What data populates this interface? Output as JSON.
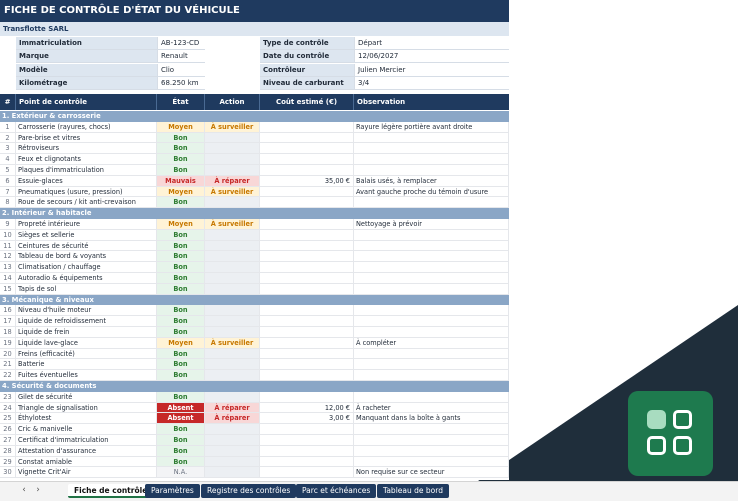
{
  "title": "FICHE DE CONTRÔLE D'ÉTAT DU VÉHICULE",
  "company": "Transflotte SARL",
  "info_left": [
    {
      "label": "Immatriculation",
      "value": "AB-123-CD"
    },
    {
      "label": "Marque",
      "value": "Renault"
    },
    {
      "label": "Modèle",
      "value": "Clio"
    },
    {
      "label": "Kilométrage",
      "value": "68.250 km"
    }
  ],
  "info_right": [
    {
      "label": "Type de contrôle",
      "value": "Départ"
    },
    {
      "label": "Date du contrôle",
      "value": "12/06/2027"
    },
    {
      "label": "Contrôleur",
      "value": "Julien Mercier"
    },
    {
      "label": "Niveau de carburant",
      "value": "3/4"
    }
  ],
  "headers": {
    "num": "#",
    "point": "Point de contrôle",
    "state": "État",
    "action": "Action",
    "cost": "Coût estimé (€)",
    "obs": "Observation"
  },
  "sections": [
    {
      "title": "1. Extérieur & carrosserie",
      "rows": [
        {
          "n": "1",
          "point": "Carrosserie (rayures, chocs)",
          "state": "Moyen",
          "action": "À surveiller",
          "cost": "",
          "obs": "Rayure légère portière avant droite"
        },
        {
          "n": "2",
          "point": "Pare-brise et vitres",
          "state": "Bon",
          "action": "",
          "cost": "",
          "obs": ""
        },
        {
          "n": "3",
          "point": "Rétroviseurs",
          "state": "Bon",
          "action": "",
          "cost": "",
          "obs": ""
        },
        {
          "n": "4",
          "point": "Feux et clignotants",
          "state": "Bon",
          "action": "",
          "cost": "",
          "obs": ""
        },
        {
          "n": "5",
          "point": "Plaques d'immatriculation",
          "state": "Bon",
          "action": "",
          "cost": "",
          "obs": ""
        },
        {
          "n": "6",
          "point": "Essuie-glaces",
          "state": "Mauvais",
          "action": "À réparer",
          "cost": "35,00 €",
          "obs": "Balais usés, à remplacer"
        },
        {
          "n": "7",
          "point": "Pneumatiques (usure, pression)",
          "state": "Moyen",
          "action": "À surveiller",
          "cost": "",
          "obs": "Avant gauche proche du témoin d'usure"
        },
        {
          "n": "8",
          "point": "Roue de secours / kit anti-crevaison",
          "state": "Bon",
          "action": "",
          "cost": "",
          "obs": ""
        }
      ]
    },
    {
      "title": "2. Intérieur & habitacle",
      "rows": [
        {
          "n": "9",
          "point": "Propreté intérieure",
          "state": "Moyen",
          "action": "À surveiller",
          "cost": "",
          "obs": "Nettoyage à prévoir"
        },
        {
          "n": "10",
          "point": "Sièges et sellerie",
          "state": "Bon",
          "action": "",
          "cost": "",
          "obs": ""
        },
        {
          "n": "11",
          "point": "Ceintures de sécurité",
          "state": "Bon",
          "action": "",
          "cost": "",
          "obs": ""
        },
        {
          "n": "12",
          "point": "Tableau de bord & voyants",
          "state": "Bon",
          "action": "",
          "cost": "",
          "obs": ""
        },
        {
          "n": "13",
          "point": "Climatisation / chauffage",
          "state": "Bon",
          "action": "",
          "cost": "",
          "obs": ""
        },
        {
          "n": "14",
          "point": "Autoradio & équipements",
          "state": "Bon",
          "action": "",
          "cost": "",
          "obs": ""
        },
        {
          "n": "15",
          "point": "Tapis de sol",
          "state": "Bon",
          "action": "",
          "cost": "",
          "obs": ""
        }
      ]
    },
    {
      "title": "3. Mécanique & niveaux",
      "rows": [
        {
          "n": "16",
          "point": "Niveau d'huile moteur",
          "state": "Bon",
          "action": "",
          "cost": "",
          "obs": ""
        },
        {
          "n": "17",
          "point": "Liquide de refroidissement",
          "state": "Bon",
          "action": "",
          "cost": "",
          "obs": ""
        },
        {
          "n": "18",
          "point": "Liquide de frein",
          "state": "Bon",
          "action": "",
          "cost": "",
          "obs": ""
        },
        {
          "n": "19",
          "point": "Liquide lave-glace",
          "state": "Moyen",
          "action": "À surveiller",
          "cost": "",
          "obs": "À compléter"
        },
        {
          "n": "20",
          "point": "Freins (efficacité)",
          "state": "Bon",
          "action": "",
          "cost": "",
          "obs": ""
        },
        {
          "n": "21",
          "point": "Batterie",
          "state": "Bon",
          "action": "",
          "cost": "",
          "obs": ""
        },
        {
          "n": "22",
          "point": "Fuites éventuelles",
          "state": "Bon",
          "action": "",
          "cost": "",
          "obs": ""
        }
      ]
    },
    {
      "title": "4. Sécurité & documents",
      "rows": [
        {
          "n": "23",
          "point": "Gilet de sécurité",
          "state": "Bon",
          "action": "",
          "cost": "",
          "obs": ""
        },
        {
          "n": "24",
          "point": "Triangle de signalisation",
          "state": "Absent",
          "action": "À réparer",
          "cost": "12,00 €",
          "obs": "À racheter"
        },
        {
          "n": "25",
          "point": "Éthylotest",
          "state": "Absent",
          "action": "À réparer",
          "cost": "3,00 €",
          "obs": "Manquant dans la boîte à gants"
        },
        {
          "n": "26",
          "point": "Cric & manivelle",
          "state": "Bon",
          "action": "",
          "cost": "",
          "obs": ""
        },
        {
          "n": "27",
          "point": "Certificat d'immatriculation",
          "state": "Bon",
          "action": "",
          "cost": "",
          "obs": ""
        },
        {
          "n": "28",
          "point": "Attestation d'assurance",
          "state": "Bon",
          "action": "",
          "cost": "",
          "obs": ""
        },
        {
          "n": "29",
          "point": "Constat amiable",
          "state": "Bon",
          "action": "",
          "cost": "",
          "obs": ""
        },
        {
          "n": "30",
          "point": "Vignette Crit'Air",
          "state": "N.A.",
          "action": "",
          "cost": "",
          "obs": "Non requise sur ce secteur"
        }
      ]
    }
  ],
  "tabs": [
    "Fiche de contrôle",
    "Paramètres",
    "Registre des contrôles",
    "Parc et échéances",
    "Tableau de bord"
  ],
  "nav": {
    "prev": "‹",
    "next": "›"
  },
  "colors": {
    "header": "#1f3a5f",
    "section": "#8aa6c6",
    "logo": "#1e7a4e",
    "corner": "#1f2e3b"
  }
}
